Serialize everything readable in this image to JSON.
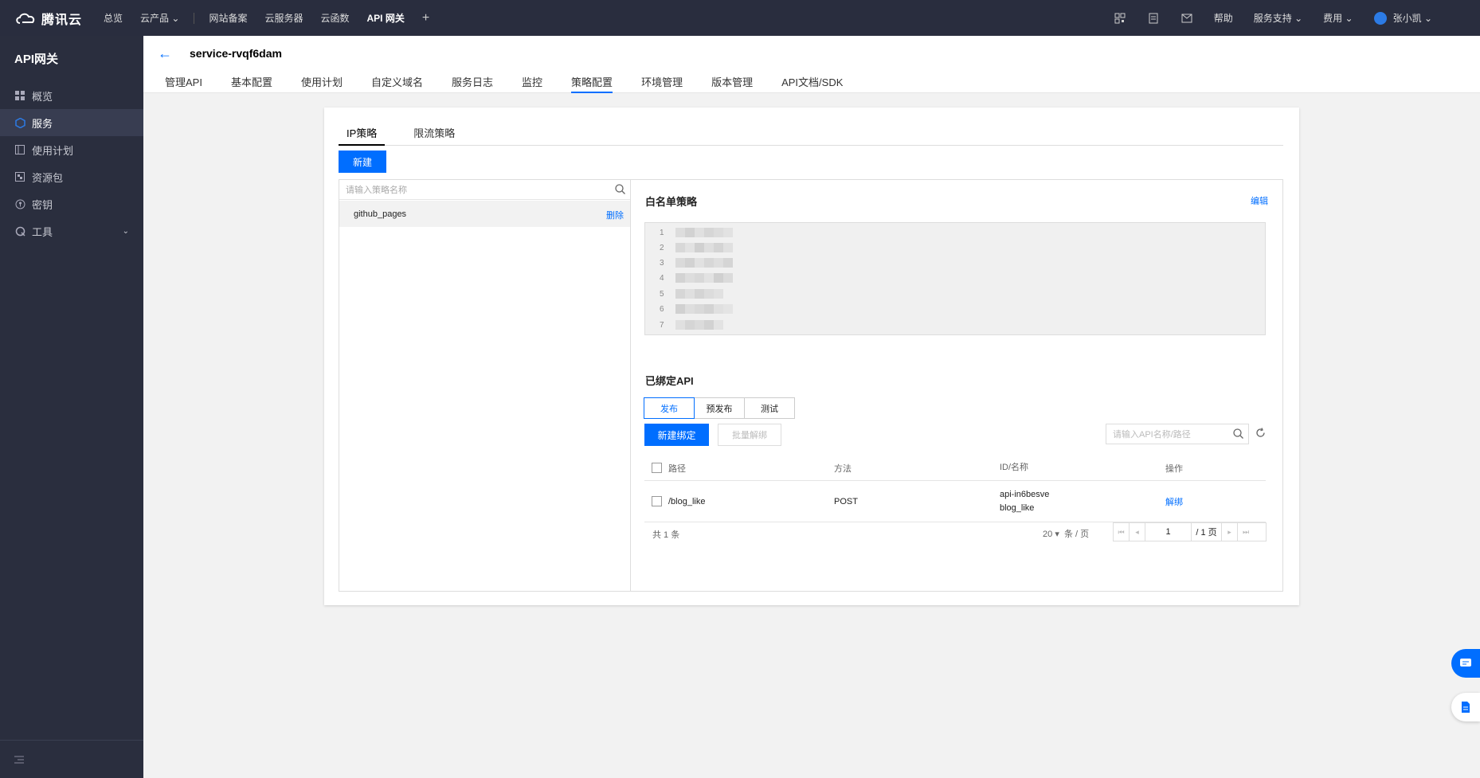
{
  "topbar": {
    "logo_text": "腾讯云",
    "nav": [
      "总览",
      "云产品",
      "网站备案",
      "云服务器",
      "云函数",
      "API 网关"
    ],
    "plus": "+",
    "right": {
      "help": "帮助",
      "support": "服务支持",
      "fee": "费用",
      "user": "张小凯"
    }
  },
  "sidebar": {
    "title": "API网关",
    "items": [
      {
        "label": "概览",
        "icon": "grid-icon"
      },
      {
        "label": "服务",
        "icon": "cube-icon"
      },
      {
        "label": "使用计划",
        "icon": "plan-icon"
      },
      {
        "label": "资源包",
        "icon": "package-icon"
      },
      {
        "label": "密钥",
        "icon": "key-icon"
      },
      {
        "label": "工具",
        "icon": "tool-icon"
      }
    ]
  },
  "header": {
    "service_name": "service-rvqf6dam",
    "tabs": [
      "管理API",
      "基本配置",
      "使用计划",
      "自定义域名",
      "服务日志",
      "监控",
      "策略配置",
      "环境管理",
      "版本管理",
      "API文档/SDK"
    ],
    "active_tab": "策略配置"
  },
  "policy": {
    "subtabs": [
      "IP策略",
      "限流策略"
    ],
    "new_label": "新建",
    "search_placeholder": "请输入策略名称",
    "list": [
      {
        "name": "github_pages",
        "delete": "删除"
      }
    ],
    "whitelist_title": "白名单策略",
    "edit_label": "编辑",
    "ip_line_numbers": [
      "1",
      "2",
      "3",
      "4",
      "5",
      "6",
      "7"
    ],
    "bound_title": "已绑定API",
    "env_tabs": [
      "发布",
      "预发布",
      "测试"
    ],
    "bind_label": "新建绑定",
    "unbind_label": "批量解绑",
    "api_search_placeholder": "请输入API名称/路径",
    "columns": [
      "路径",
      "方法",
      "ID/名称",
      "操作"
    ],
    "rows": [
      {
        "path": "/blog_like",
        "method": "POST",
        "id": "api-in6besve",
        "name": "blog_like",
        "op": "解绑"
      }
    ],
    "total": "共 1 条",
    "page_size": "20",
    "page_size_unit": "条 / 页",
    "current_page": "1",
    "total_pages": "/ 1 页"
  },
  "colors": {
    "accent": "#006eff",
    "topbar": "#292d3e",
    "sidebar": "#2a2e3e"
  }
}
